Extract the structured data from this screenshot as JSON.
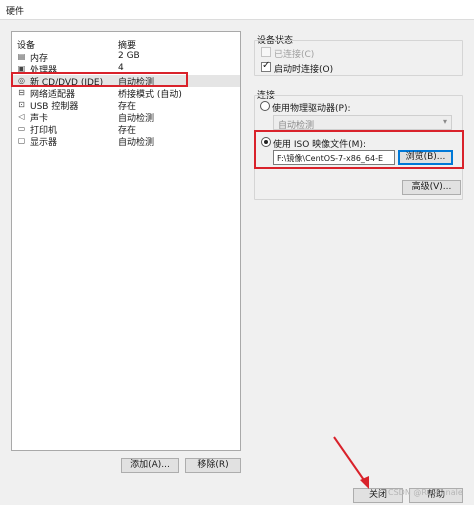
{
  "window": {
    "title": "硬件"
  },
  "device_list": {
    "headers": {
      "device": "设备",
      "summary": "摘要"
    },
    "items": [
      {
        "icon": "memory-icon",
        "name": "内存",
        "summary": "2 GB"
      },
      {
        "icon": "processor-icon",
        "name": "处理器",
        "summary": "4"
      },
      {
        "icon": "cd-dvd-icon",
        "name": "新 CD/DVD (IDE)",
        "summary": "自动检测",
        "selected": true
      },
      {
        "icon": "network-adapter-icon",
        "name": "网络适配器",
        "summary": "桥接模式 (自动)"
      },
      {
        "icon": "usb-controller-icon",
        "name": "USB 控制器",
        "summary": "存在"
      },
      {
        "icon": "sound-card-icon",
        "name": "声卡",
        "summary": "自动检测"
      },
      {
        "icon": "printer-icon",
        "name": "打印机",
        "summary": "存在"
      },
      {
        "icon": "display-icon",
        "name": "显示器",
        "summary": "自动检测"
      }
    ],
    "add_button": "添加(A)...",
    "remove_button": "移除(R)"
  },
  "device_status": {
    "title": "设备状态",
    "connected_label": "已连接(C)",
    "connected_checked": false,
    "connected_enabled": false,
    "power_on_label": "启动时连接(O)",
    "power_on_checked": true
  },
  "connection": {
    "title": "连接",
    "physical_drive_label": "使用物理驱动器(P):",
    "physical_drive_value": "自动检测",
    "iso_label": "使用 ISO 映像文件(M):",
    "iso_path": "F:\\镜像\\CentOS-7-x86_64-E",
    "browse_button": "浏览(B)...",
    "selected_option": "iso"
  },
  "advanced_button": "高级(V)...",
  "footer": {
    "close_button": "关闭",
    "help_button": "帮助"
  },
  "watermark": "CSDN @Ru_Kanale",
  "colors": {
    "highlight_red": "#d9222b",
    "focus_blue": "#0078d7"
  }
}
